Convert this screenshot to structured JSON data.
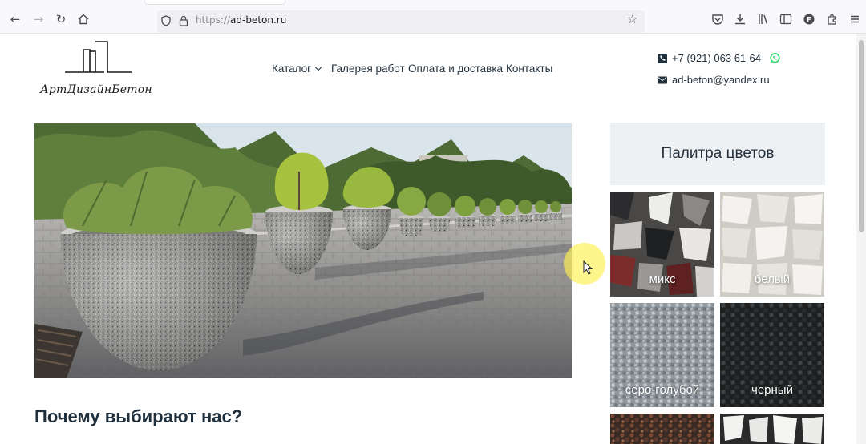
{
  "browser": {
    "url_scheme": "https://",
    "url_host": "ad-beton.ru"
  },
  "site": {
    "logo_text": "АртДизайнБетон",
    "nav": [
      {
        "label": "Каталог",
        "has_dropdown": true
      },
      {
        "label": "Галерея работ",
        "has_dropdown": false
      },
      {
        "label": "Оплата и доставка",
        "has_dropdown": false
      },
      {
        "label": "Контакты",
        "has_dropdown": false
      }
    ],
    "phone": "+7 (921) 063 61-64",
    "email": "ad-beton@yandex.ru",
    "accent_color": "#25d366"
  },
  "hero": {
    "icon": "hero-image"
  },
  "main": {
    "why_title": "Почему выбирают нас?"
  },
  "palette": {
    "title": "Палитра цветов",
    "items": [
      {
        "label": "микс",
        "color": "#6f6d6a"
      },
      {
        "label": "белый",
        "color": "#e6e4df"
      },
      {
        "label": "серо-голубой",
        "color": "#9aa0a6"
      },
      {
        "label": "черный",
        "color": "#2a2d2f"
      },
      {
        "label": "",
        "color": "#5a3a2c"
      },
      {
        "label": "",
        "color": "#efefed"
      }
    ]
  }
}
